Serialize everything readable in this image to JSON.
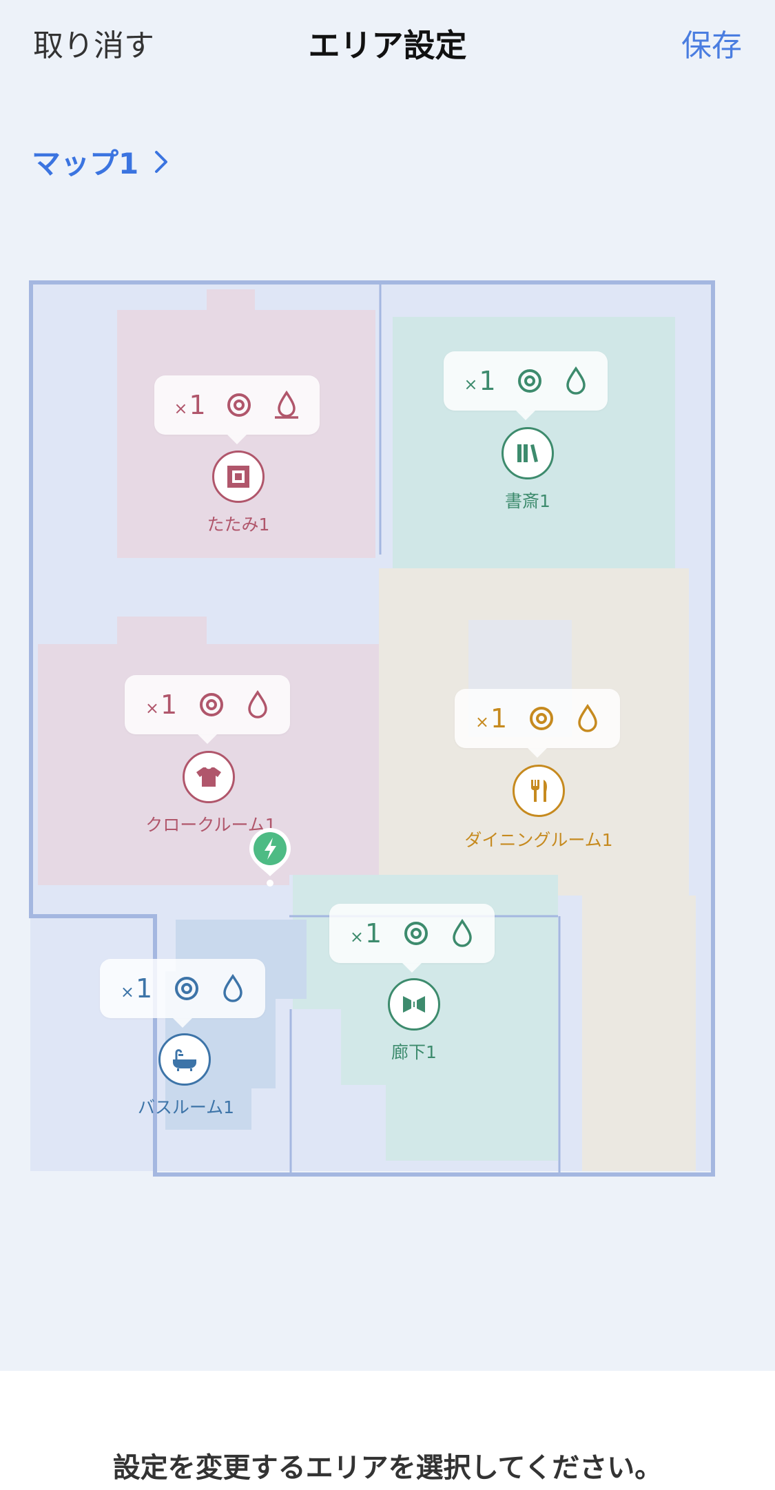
{
  "header": {
    "cancel_label": "取り消す",
    "title": "エリア設定",
    "save_label": "保存"
  },
  "map_selector": {
    "label": "マップ1"
  },
  "rooms": [
    {
      "name": "たたみ1",
      "count": "1",
      "color": "#b0566b",
      "icon": "tatami-icon"
    },
    {
      "name": "書斎1",
      "count": "1",
      "color": "#3d8b6d",
      "icon": "books-icon"
    },
    {
      "name": "クロークルーム1",
      "count": "1",
      "color": "#b0566b",
      "icon": "shirt-icon"
    },
    {
      "name": "ダイニングルーム1",
      "count": "1",
      "color": "#c68a1f",
      "icon": "cutlery-icon"
    },
    {
      "name": "廊下1",
      "count": "1",
      "color": "#3d8b6d",
      "icon": "corridor-icon"
    },
    {
      "name": "バスルーム1",
      "count": "1",
      "color": "#3d74a8",
      "icon": "bathtub-icon"
    }
  ],
  "dock": {
    "icon": "charging-dock-icon",
    "color": "#4dbb84"
  },
  "footer": {
    "instruction": "設定を変更するエリアを選択してください。"
  }
}
